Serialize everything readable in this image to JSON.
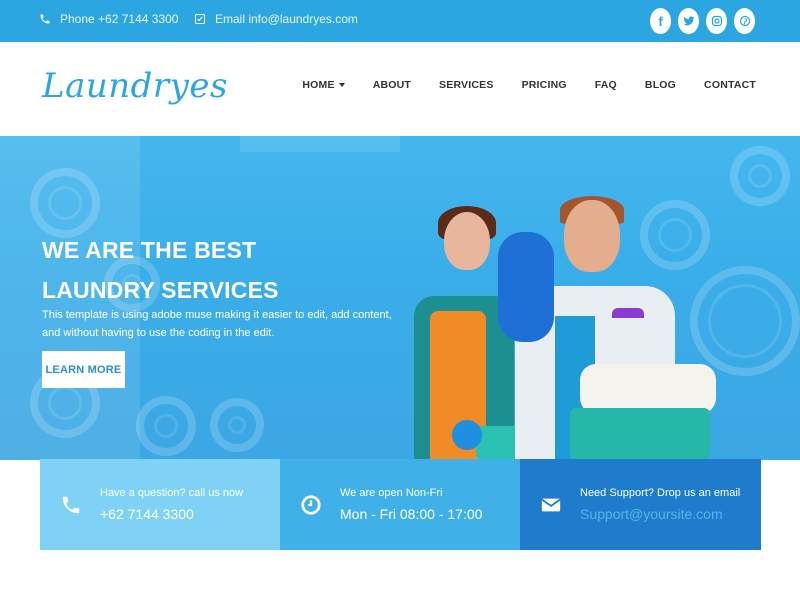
{
  "topbar": {
    "phone": "Phone +62 7144 3300",
    "email": "Email info@laundryes.com",
    "social": [
      {
        "icon": "facebook-icon",
        "glyph": "f"
      },
      {
        "icon": "twitter-icon",
        "glyph": "t"
      },
      {
        "icon": "instagram-icon",
        "glyph": "◻"
      },
      {
        "icon": "pinterest-icon",
        "glyph": "p"
      }
    ]
  },
  "header": {
    "logo": "Laundryes",
    "nav": [
      "HOME",
      "ABOUT",
      "SERVICES",
      "PRICING",
      "FAQ",
      "BLOG",
      "CONTACT"
    ]
  },
  "hero": {
    "title": "WE ARE THE BEST LAUNDRY SERVICES",
    "description": "This template is using adobe muse making it easier to edit, add content, and without having to use the coding in the edit.",
    "button": "LEARN MORE"
  },
  "info": [
    {
      "icon": "phone-icon",
      "line1": "Have a question? call us now",
      "line2": "+62 7144 3300"
    },
    {
      "icon": "clock-icon",
      "line1": "We are open Non-Fri",
      "line2": "Mon - Fri 08:00 - 17:00"
    },
    {
      "icon": "envelope-icon",
      "line1": "Need Support? Drop us an email",
      "line2": "Support@yoursite.com"
    }
  ],
  "colors": {
    "brand": "#2ca6e0",
    "box1": "#7fd2f6",
    "box2": "#3fb0e8",
    "box3": "#1f7ccc"
  }
}
